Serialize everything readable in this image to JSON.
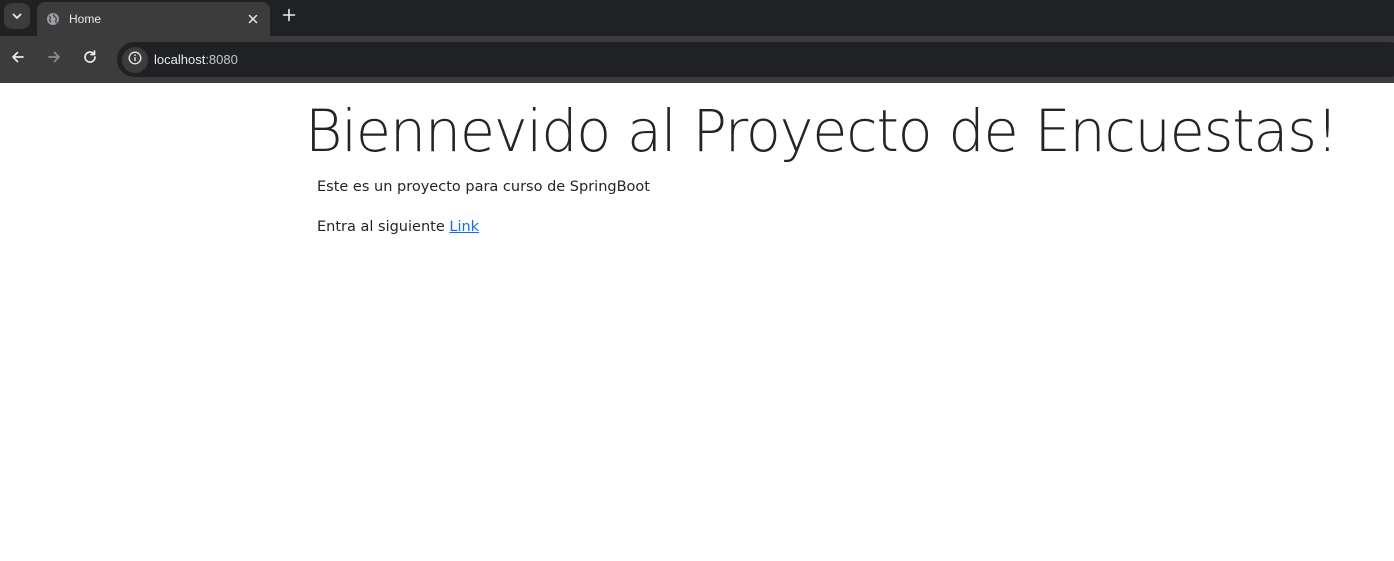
{
  "browser": {
    "tab": {
      "title": "Home"
    },
    "address_bar": {
      "host": "localhost",
      "port": ":8080"
    }
  },
  "page": {
    "heading": "Biennevido al Proyecto de Encuestas!",
    "description": "Este es un proyecto para curso de SpringBoot",
    "link_prompt": "Entra al siguiente ",
    "link_label": "Link"
  },
  "colors": {
    "chrome_dark": "#202124",
    "chrome_mid": "#3c3c3c",
    "text": "#212529",
    "link": "#0d6efd"
  }
}
